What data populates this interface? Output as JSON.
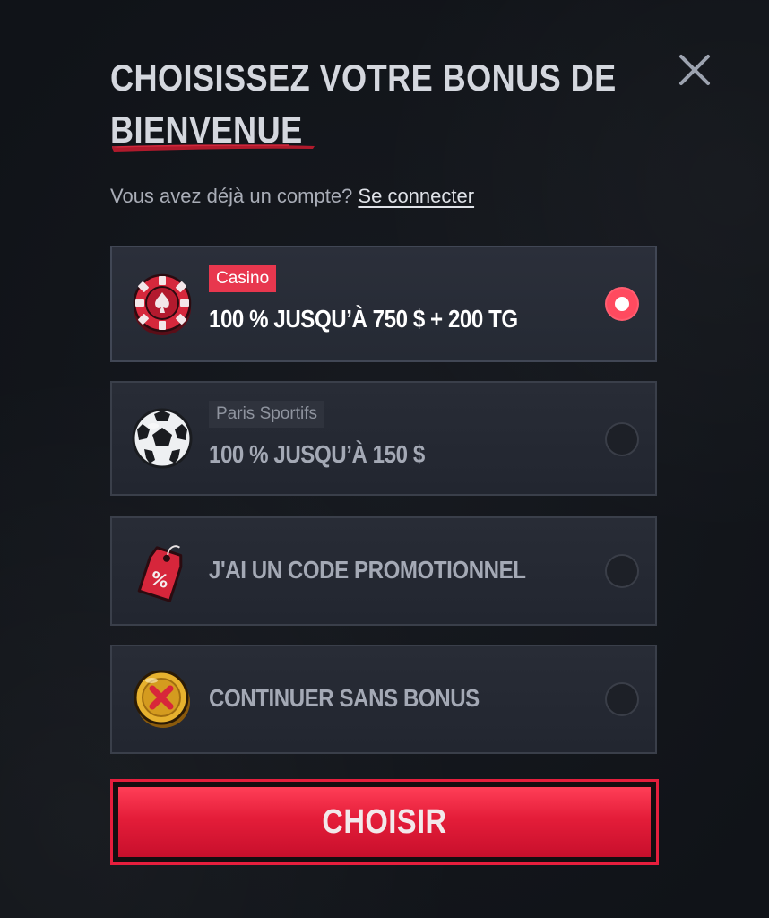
{
  "modal": {
    "title_line1": "CHOISISSEZ VOTRE BONUS DE",
    "title_line2": "BIENVENUE",
    "account_prompt": "Vous avez déjà un compte?",
    "login_link": "Se connecter",
    "close_icon": "close-icon"
  },
  "options": [
    {
      "tag": "Casino",
      "label": "100 % JUSQU’À 750 $ + 200 TG",
      "icon": "casino-chip-icon",
      "selected": true
    },
    {
      "tag": "Paris Sportifs",
      "label": "100 % JUSQU’À 150 $",
      "icon": "soccer-ball-icon",
      "selected": false
    },
    {
      "label": "J'AI UN CODE PROMOTIONNEL",
      "icon": "promo-tag-icon",
      "selected": false
    },
    {
      "label": "CONTINUER SANS BONUS",
      "icon": "no-bonus-coin-icon",
      "selected": false
    }
  ],
  "submit": {
    "label": "CHOISIR"
  },
  "colors": {
    "accent": "#e8374e",
    "background": "#14171c",
    "card": "#262a34"
  }
}
